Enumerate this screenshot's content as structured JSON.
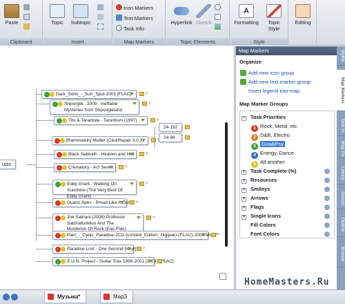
{
  "ribbon": {
    "clipboard": {
      "label": "Clipboard",
      "paste": "Paste"
    },
    "insert": {
      "label": "Insert",
      "topic": "Topic",
      "subtopic": "Subtopic"
    },
    "map_markers": {
      "label": "Map Markers",
      "icon_markers": "Icon Markers",
      "text_markers": "Text Markers",
      "task_info": "Task Info"
    },
    "topic_elements": {
      "label": "Topic Elements",
      "hyperlink": "Hyperlink",
      "sketch": "Sketch"
    },
    "style": {
      "label": "Style",
      "formatting": "Formatting",
      "topic_style": "Topic\nStyle",
      "topic_style_line1": "Topic",
      "topic_style_line2": "Style"
    },
    "editing": {
      "editing": "Editing"
    }
  },
  "map": {
    "central": "usic",
    "topics": [
      {
        "text": "Dark_Soho_-_Sun_Spot-2001 [FLAC]",
        "priority": "3"
      },
      {
        "text": "Shpongle . 2009 . Ineffable Mysteries from Shpongleland",
        "priority": "3"
      },
      {
        "text": "Tito & Tarantula - Tarantism (1997)",
        "priority": "3"
      },
      {
        "text": "[Rammstein] Mutter (ClickRepair 3.0.1)",
        "priority": "1"
      },
      {
        "text": "Black Sabbath - Heaven and Hell",
        "priority": "1"
      },
      {
        "text": "Crematory - Act Seven",
        "priority": "1"
      },
      {
        "text": "Eddy Grant - Walking On Sunshine (The Very Best Of Eddy Grant)",
        "priority": "3"
      },
      {
        "text": "Guano Apes - Proud Like A God",
        "priority": "1"
      },
      {
        "text": "Joe Satriani (2008) Professor Satchafunkilus And The Musterion Of Rock (Eac-Flac)",
        "priority": "1"
      },
      {
        "text": "Pain_-_Cynic_Paradise-2CD-(Limited_Edition_Digipak)-(FLAC)-2008-MoFF",
        "priority": "1"
      },
      {
        "text": "Paradise Lost - One Second [vinyl]",
        "priority": "1"
      },
      {
        "text": "S.U.N. Project - Guitar Trax 1996-2001 (2001) [FLAC]",
        "priority": "3"
      }
    ],
    "subtopics": [
      "24-192",
      "24-96"
    ]
  },
  "pane": {
    "title": "Map Markers",
    "organize": "Organize",
    "add_icon_group": "Add new icon group",
    "add_text_group": "Add new text marker group",
    "insert_legend": "Insert legend into map",
    "groups_heading": "Map Marker Groups",
    "task_priorities": "Task Priorities",
    "priorities": [
      {
        "num": "1",
        "label": "Rock, Metal, etc",
        "color": "#d93a2b"
      },
      {
        "num": "2",
        "label": "D&B, Electro",
        "color": "#e47d22"
      },
      {
        "num": "3",
        "label": "Goa&Psy",
        "color": "#3aa43a"
      },
      {
        "num": "4",
        "label": "Energy, Dance",
        "color": "#2e6fc9"
      },
      {
        "num": "5",
        "label": "All another",
        "color": "#e6c228"
      }
    ],
    "groups": [
      "Task Complete (%)",
      "Resources",
      "Smileys",
      "Arrows",
      "Flags",
      "Single Icons",
      "Fill Colors",
      "Font Colors"
    ]
  },
  "sidetabs": [
    "MyMa",
    "Map Markers",
    "Task In",
    "Map Pa",
    "Library",
    "Search",
    "Outline",
    "Browse"
  ],
  "tabs": {
    "active": "Музыка*",
    "second": "Мар3"
  },
  "watermark": "HomeMasters.Ru",
  "colors": {
    "p1": "#d93a2b",
    "p3": "#3aa43a",
    "selection": "#3e80d8"
  }
}
